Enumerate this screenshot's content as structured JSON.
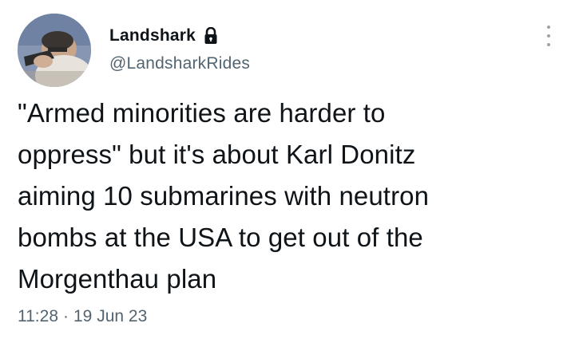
{
  "tweet": {
    "display_name": "Landshark",
    "handle": "@LandsharkRides",
    "protected_icon": "lock-icon",
    "more_icon": "more-vertical-icon",
    "text": "\"Armed minorities are harder to\noppress\" but it's about Karl Donitz\naiming 10 submarines with neutron\nbombs at the USA to get out of the\nMorgenthau plan",
    "time": "11:28",
    "separator": "·",
    "date": "19 Jun 23"
  },
  "colors": {
    "text_primary": "#0f1419",
    "text_secondary": "#536471",
    "background": "#ffffff"
  }
}
